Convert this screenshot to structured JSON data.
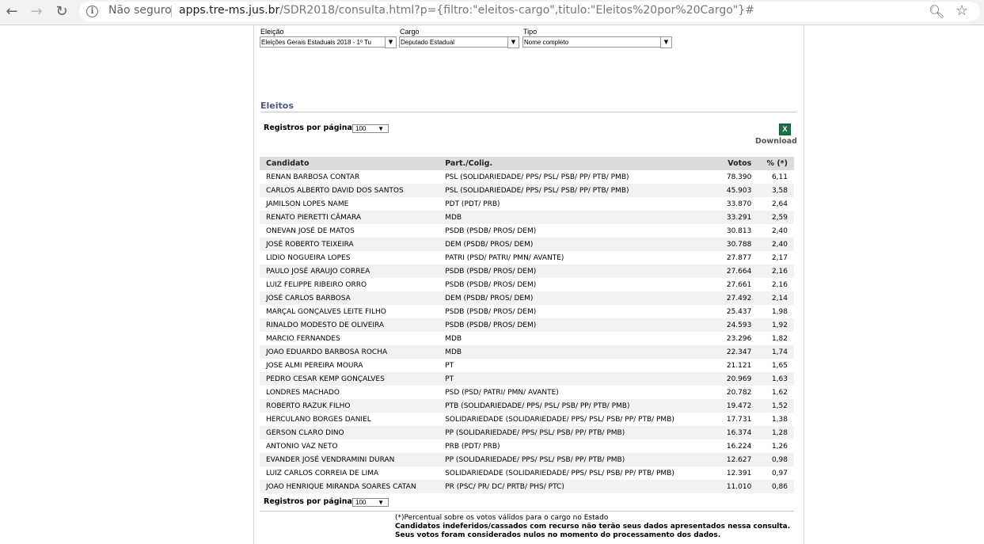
{
  "browser": {
    "security_label": "Não seguro",
    "url_host": "apps.tre-ms.jus.br",
    "url_rest": "/SDR2018/consulta.html?p={filtro:\"eleitos-cargo\",titulo:\"Eleitos%20por%20Cargo\"}#"
  },
  "filters": {
    "eleicao": {
      "label": "Eleição",
      "value": "Eleições Gerais Estaduais 2018 - 1º Tu"
    },
    "cargo": {
      "label": "Cargo",
      "value": "Deputado Estadual"
    },
    "tipo": {
      "label": "Tipo",
      "value": "Nome completo"
    }
  },
  "section": {
    "title": "Eleitos"
  },
  "pagination": {
    "label": "Registros por página :",
    "value": "100"
  },
  "download": {
    "label": "Download"
  },
  "table": {
    "headers": {
      "candidato": "Candidato",
      "partido": "Part./Colig.",
      "votos": "Votos",
      "pct": "% (*)"
    },
    "rows": [
      {
        "candidato": "RENAN BARBOSA CONTAR",
        "partido": "PSL (SOLIDARIEDADE/ PPS/ PSL/ PSB/ PP/ PTB/ PMB)",
        "votos": "78.390",
        "pct": "6,11"
      },
      {
        "candidato": "CARLOS ALBERTO DAVID DOS SANTOS",
        "partido": "PSL (SOLIDARIEDADE/ PPS/ PSL/ PSB/ PP/ PTB/ PMB)",
        "votos": "45.903",
        "pct": "3,58"
      },
      {
        "candidato": "JAMILSON LOPES NAME",
        "partido": "PDT (PDT/ PRB)",
        "votos": "33.870",
        "pct": "2,64"
      },
      {
        "candidato": "RENATO PIERETTI CÂMARA",
        "partido": "MDB",
        "votos": "33.291",
        "pct": "2,59"
      },
      {
        "candidato": "ONEVAN JOSÉ DE MATOS",
        "partido": "PSDB (PSDB/ PROS/ DEM)",
        "votos": "30.813",
        "pct": "2,40"
      },
      {
        "candidato": "JOSÉ ROBERTO TEIXEIRA",
        "partido": "DEM (PSDB/ PROS/ DEM)",
        "votos": "30.788",
        "pct": "2,40"
      },
      {
        "candidato": "LIDIO NOGUEIRA LOPES",
        "partido": "PATRI (PSD/ PATRI/ PMN/ AVANTE)",
        "votos": "27.877",
        "pct": "2,17"
      },
      {
        "candidato": "PAULO JOSÉ ARAUJO CORREA",
        "partido": "PSDB (PSDB/ PROS/ DEM)",
        "votos": "27.664",
        "pct": "2,16"
      },
      {
        "candidato": "LUIZ FELIPPE RIBEIRO ORRO",
        "partido": "PSDB (PSDB/ PROS/ DEM)",
        "votos": "27.661",
        "pct": "2,16"
      },
      {
        "candidato": "JOSÉ CARLOS BARBOSA",
        "partido": "DEM (PSDB/ PROS/ DEM)",
        "votos": "27.492",
        "pct": "2,14"
      },
      {
        "candidato": "MARÇAL GONÇALVES LEITE FILHO",
        "partido": "PSDB (PSDB/ PROS/ DEM)",
        "votos": "25.437",
        "pct": "1,98"
      },
      {
        "candidato": "RINALDO MODESTO DE OLIVEIRA",
        "partido": "PSDB (PSDB/ PROS/ DEM)",
        "votos": "24.593",
        "pct": "1,92"
      },
      {
        "candidato": "MARCIO FERNANDES",
        "partido": "MDB",
        "votos": "23.296",
        "pct": "1,82"
      },
      {
        "candidato": "JOAO EDUARDO BARBOSA ROCHA",
        "partido": "MDB",
        "votos": "22.347",
        "pct": "1,74"
      },
      {
        "candidato": "JOSE ALMI PEREIRA MOURA",
        "partido": "PT",
        "votos": "21.121",
        "pct": "1,65"
      },
      {
        "candidato": "PEDRO CESAR KEMP GONÇALVES",
        "partido": "PT",
        "votos": "20.969",
        "pct": "1,63"
      },
      {
        "candidato": "LONDRES MACHADO",
        "partido": "PSD (PSD/ PATRI/ PMN/ AVANTE)",
        "votos": "20.782",
        "pct": "1,62"
      },
      {
        "candidato": "ROBERTO RAZUK FILHO",
        "partido": "PTB (SOLIDARIEDADE/ PPS/ PSL/ PSB/ PP/ PTB/ PMB)",
        "votos": "19.472",
        "pct": "1,52"
      },
      {
        "candidato": "HERCULANO BORGES DANIEL",
        "partido": "SOLIDARIEDADE (SOLIDARIEDADE/ PPS/ PSL/ PSB/ PP/ PTB/ PMB)",
        "votos": "17.731",
        "pct": "1,38"
      },
      {
        "candidato": "GERSON CLARO DINO",
        "partido": "PP (SOLIDARIEDADE/ PPS/ PSL/ PSB/ PP/ PTB/ PMB)",
        "votos": "16.374",
        "pct": "1,28"
      },
      {
        "candidato": "ANTONIO VAZ NETO",
        "partido": "PRB (PDT/ PRB)",
        "votos": "16.224",
        "pct": "1,26"
      },
      {
        "candidato": "EVANDER JOSÉ VENDRAMINI DURAN",
        "partido": "PP (SOLIDARIEDADE/ PPS/ PSL/ PSB/ PP/ PTB/ PMB)",
        "votos": "12.627",
        "pct": "0,98"
      },
      {
        "candidato": "LUIZ CARLOS CORREIA DE LIMA",
        "partido": "SOLIDARIEDADE (SOLIDARIEDADE/ PPS/ PSL/ PSB/ PP/ PTB/ PMB)",
        "votos": "12.391",
        "pct": "0,97"
      },
      {
        "candidato": "JOAO HENRIQUE MIRANDA SOARES CATAN",
        "partido": "PR (PSC/ PR/ DC/ PRTB/ PHS/ PTC)",
        "votos": "11.010",
        "pct": "0,86"
      }
    ]
  },
  "footnotes": {
    "line1": "(*)Percentual sobre os votos válidos para o cargo no Estado",
    "line2": "Candidatos indeferidos/cassados com recurso não terão seus dados apresentados nessa consulta.",
    "line3": "Seus votos foram considerados nulos no momento do processamento dos dados."
  },
  "colors": {
    "section_title": "#4a5a82",
    "header_bg": "#dcdcdc",
    "alt_row": "#f2f2f2",
    "excel_green": "#1e7145"
  },
  "icons": [
    "back-icon",
    "forward-icon",
    "reload-icon",
    "info-icon",
    "zoom-icon",
    "star-icon",
    "excel-icon",
    "dropdown-arrow-icon"
  ]
}
